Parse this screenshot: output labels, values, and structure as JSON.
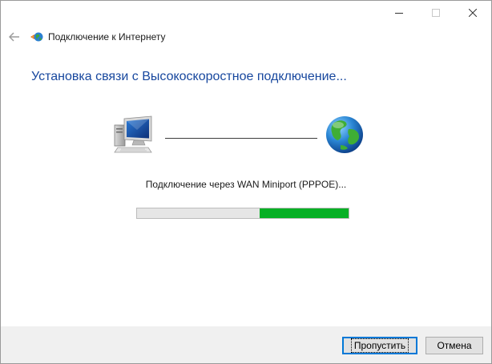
{
  "window": {
    "title": "Подключение к Интернету",
    "controls": [
      "minimize",
      "maximize",
      "close"
    ]
  },
  "heading": "Установка связи с Высокоскоростное подключение...",
  "status": "Подключение через WAN Miniport (PPPOE)...",
  "progress": {
    "fill_start": 0.58,
    "fill_end": 1.0
  },
  "buttons": {
    "skip": "Пропустить",
    "cancel": "Отмена"
  },
  "icons": {
    "back": "back-arrow-icon",
    "app": "internet-connection-icon",
    "computer": "computer-icon",
    "globe": "globe-icon"
  },
  "colors": {
    "heading": "#17479e",
    "progress_fill": "#06b025",
    "progress_track": "#e6e6e6",
    "footer_bg": "#f0f0f0",
    "focus_border": "#0078d7"
  }
}
